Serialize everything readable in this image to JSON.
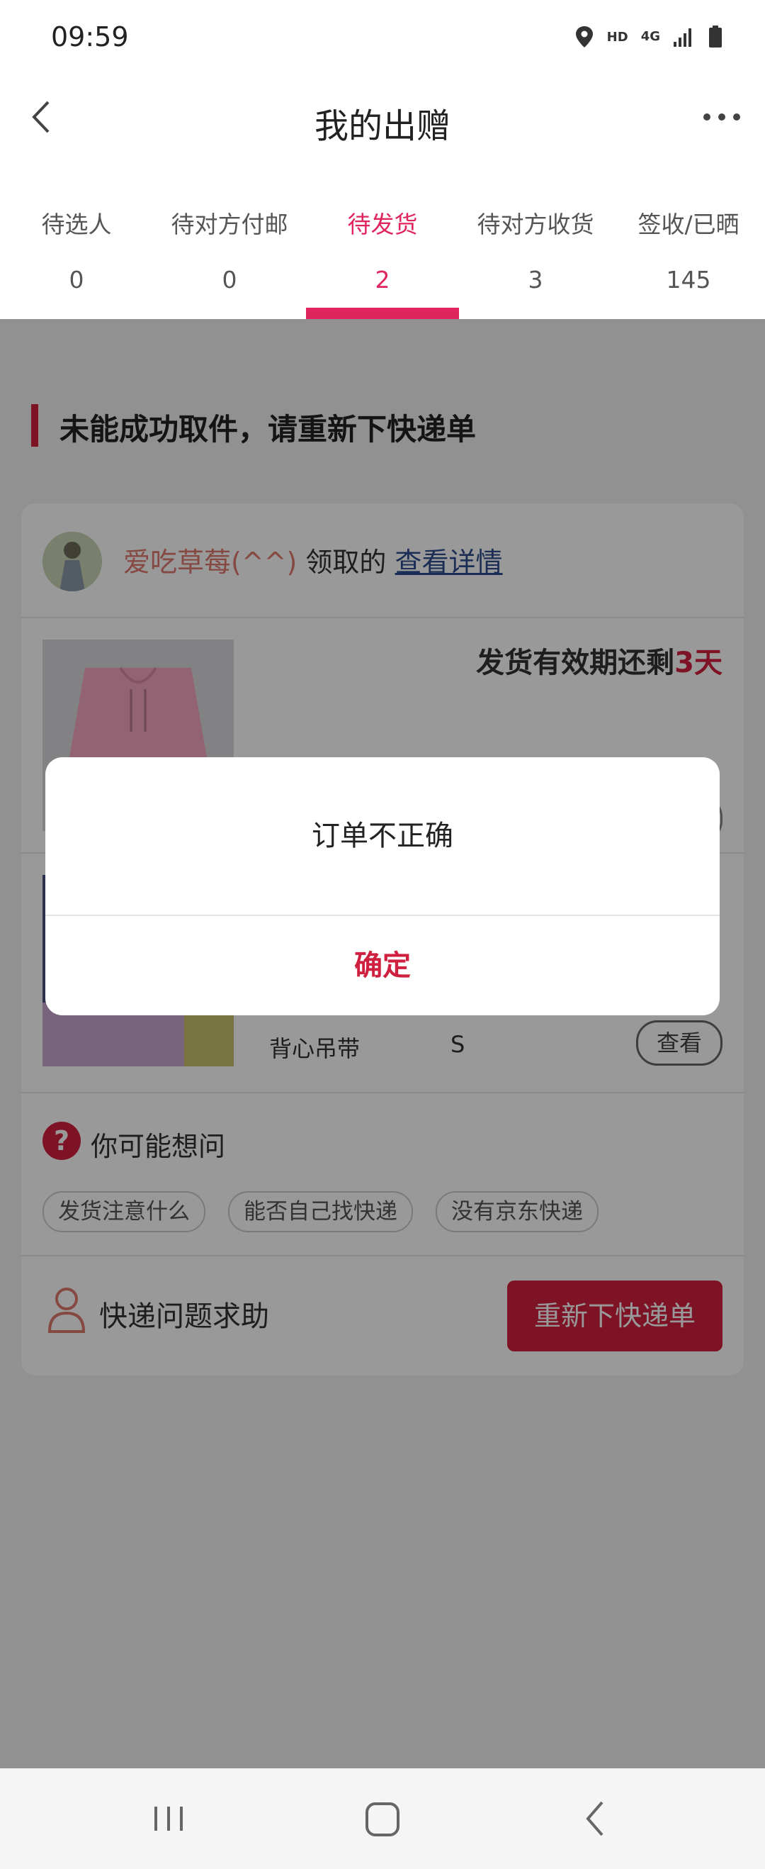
{
  "status_bar": {
    "time": "09:59",
    "hd": "HD",
    "network": "4G"
  },
  "nav": {
    "title": "我的出赠",
    "back_icon": "chevron-left-icon",
    "more_icon": "more-horizontal-icon"
  },
  "tabs": [
    {
      "label": "待选人",
      "count": "0",
      "active": false
    },
    {
      "label": "待对方付邮",
      "count": "0",
      "active": false
    },
    {
      "label": "待发货",
      "count": "2",
      "active": true
    },
    {
      "label": "待对方收货",
      "count": "3",
      "active": false
    },
    {
      "label": "签收/已晒",
      "count": "145",
      "active": false
    }
  ],
  "section": {
    "title": "未能成功取件，请重新下快递单"
  },
  "receiver": {
    "name": "爱吃草莓(^^)",
    "middle": " 领取的 ",
    "link": "查看详情"
  },
  "item1": {
    "deadline_prefix": "发货有效期还剩",
    "deadline_days": "3天"
  },
  "item2": {
    "name": "背心吊带",
    "size": "S",
    "view_label": "查看"
  },
  "faq": {
    "title": "你可能想问",
    "icon": "?",
    "chips": [
      "发货注意什么",
      "能否自己找快递",
      "没有京东快递"
    ]
  },
  "help": {
    "text": "快递问题求助",
    "button": "重新下快递单"
  },
  "dialog": {
    "message": "订单不正确",
    "confirm": "确定"
  },
  "colors": {
    "accent": "#e0245e",
    "brand_red": "#d0203f",
    "link": "#2f4d8f"
  }
}
